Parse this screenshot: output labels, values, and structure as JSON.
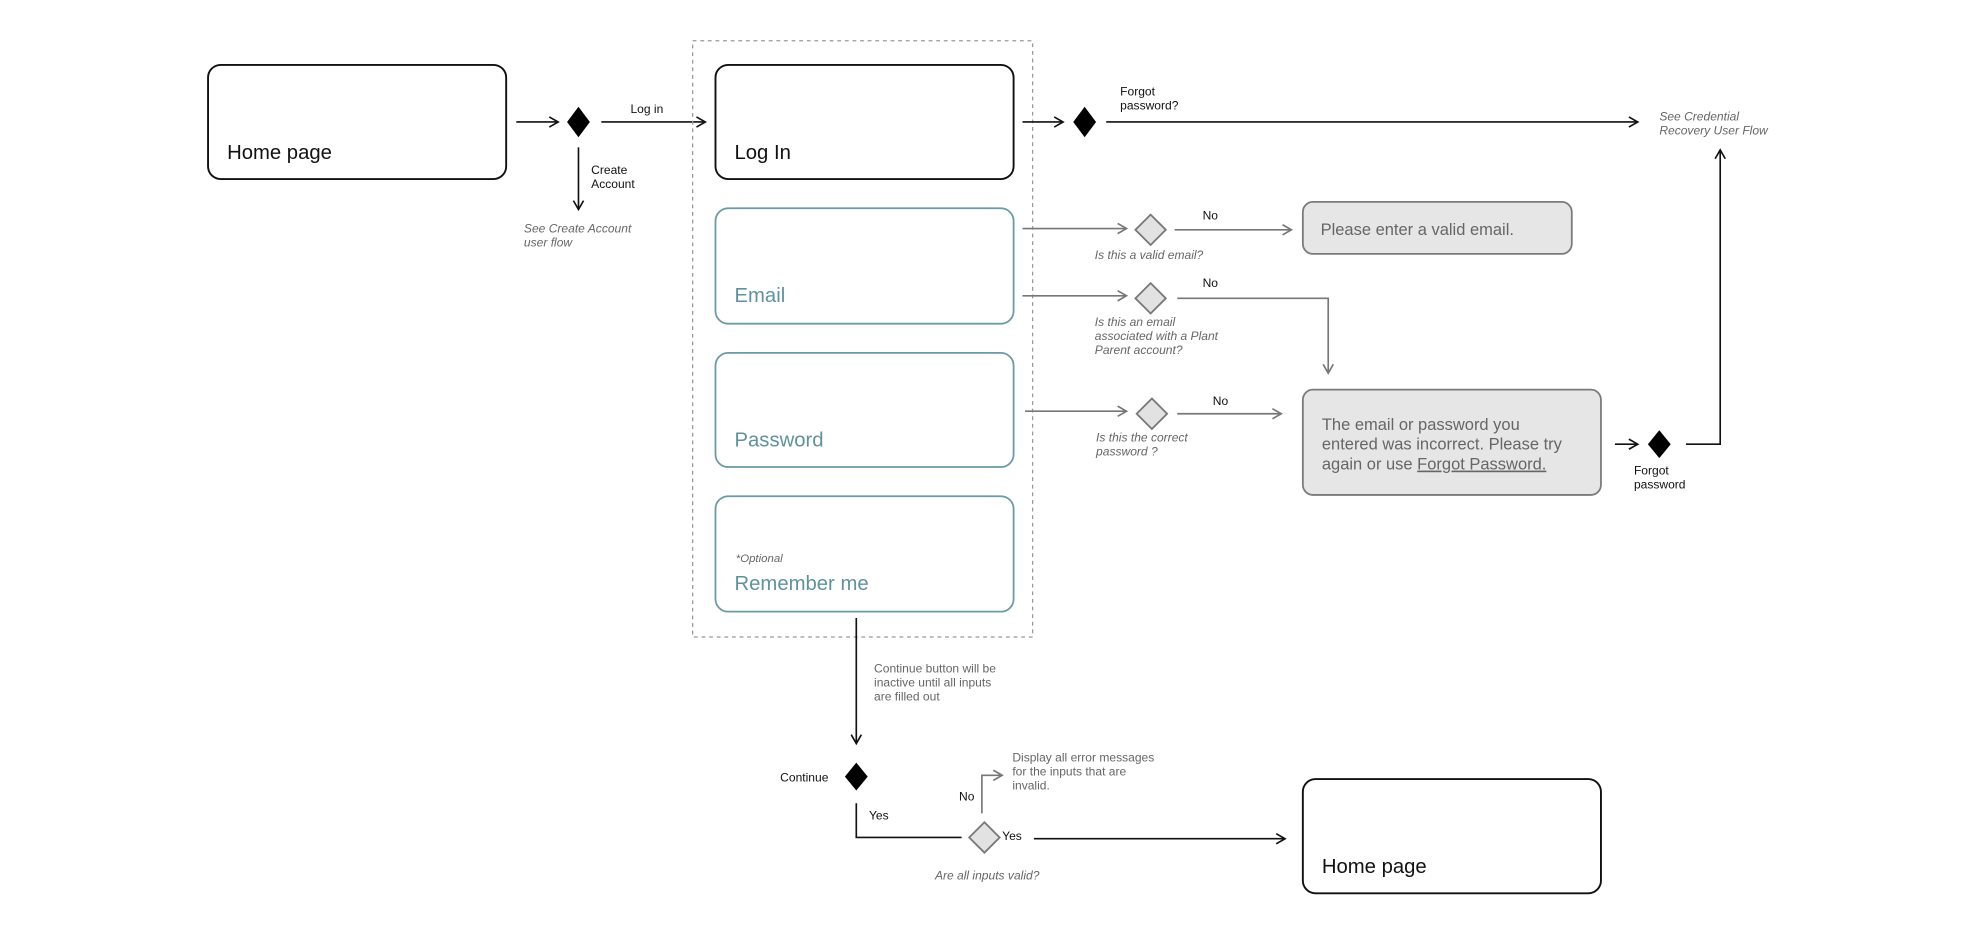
{
  "nodes": {
    "home_start": "Home page",
    "login": "Log In",
    "email": "Email",
    "password": "Password",
    "remember_optional": "*Optional",
    "remember": "Remember me",
    "home_end": "Home page"
  },
  "edges": {
    "log_in": "Log in",
    "create_account": [
      "Create",
      "Account"
    ],
    "see_create_account": [
      "See Create Account",
      "user flow"
    ],
    "forgot_password_q": [
      "Forgot",
      "password?"
    ],
    "see_credential": [
      "See Credential",
      "Recovery User Flow"
    ],
    "no1": "No",
    "no2": "No",
    "no3": "No",
    "forgot_password": [
      "Forgot",
      "password"
    ],
    "continue_note": [
      "Continue button will be",
      "inactive until all inputs",
      "are filled out"
    ],
    "continue": "Continue",
    "yes1": "Yes",
    "yes2": "Yes",
    "no4": "No",
    "display_errors": [
      "Display all error messages",
      "for the inputs that are",
      "invalid."
    ]
  },
  "decisions": {
    "valid_email": "Is this a valid email?",
    "associated": [
      "Is this an email",
      "associated with a Plant",
      "Parent account?"
    ],
    "correct_password": [
      "Is this the correct",
      "password ?"
    ],
    "all_valid": "Are all inputs valid?"
  },
  "errors": {
    "invalid_email": "Please enter a valid email.",
    "incorrect": [
      "The email or password you",
      "entered was incorrect. Please try",
      "again or use "
    ],
    "incorrect_link": "Forgot Password."
  },
  "colors": {
    "input_border": "#6a9aa6",
    "input_text": "#5f929e",
    "error_fill": "#e6e6e6"
  }
}
